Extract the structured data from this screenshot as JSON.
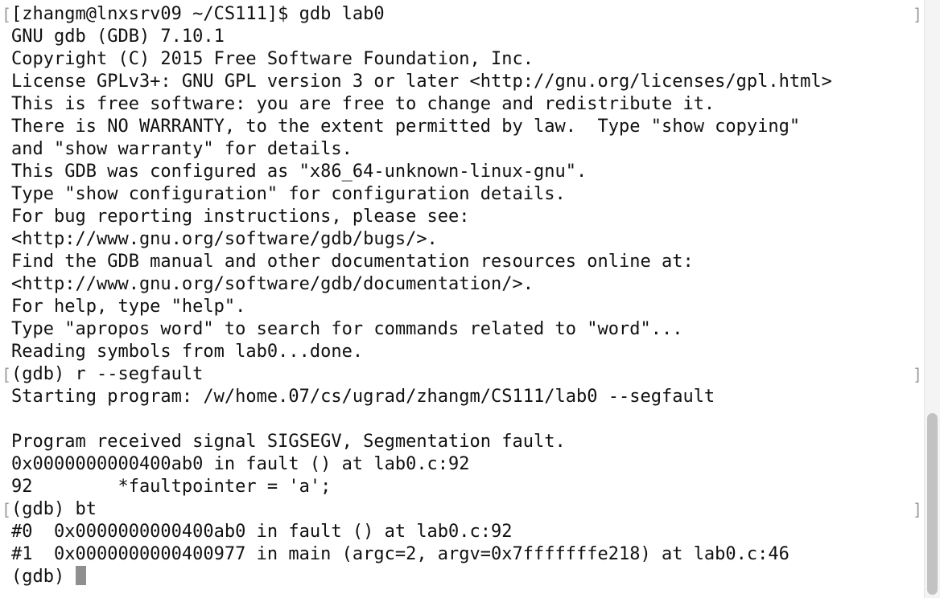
{
  "terminal": {
    "lines": [
      "[zhangm@lnxsrv09 ~/CS111]$ gdb lab0",
      "GNU gdb (GDB) 7.10.1",
      "Copyright (C) 2015 Free Software Foundation, Inc.",
      "License GPLv3+: GNU GPL version 3 or later <http://gnu.org/licenses/gpl.html>",
      "This is free software: you are free to change and redistribute it.",
      "There is NO WARRANTY, to the extent permitted by law.  Type \"show copying\"",
      "and \"show warranty\" for details.",
      "This GDB was configured as \"x86_64-unknown-linux-gnu\".",
      "Type \"show configuration\" for configuration details.",
      "For bug reporting instructions, please see:",
      "<http://www.gnu.org/software/gdb/bugs/>.",
      "Find the GDB manual and other documentation resources online at:",
      "<http://www.gnu.org/software/gdb/documentation/>.",
      "For help, type \"help\".",
      "Type \"apropos word\" to search for commands related to \"word\"...",
      "Reading symbols from lab0...done.",
      "(gdb) r --segfault",
      "Starting program: /w/home.07/cs/ugrad/zhangm/CS111/lab0 --segfault",
      "",
      "Program received signal SIGSEGV, Segmentation fault.",
      "0x0000000000400ab0 in fault () at lab0.c:92",
      "92        *faultpointer = 'a';",
      "(gdb) bt",
      "#0  0x0000000000400ab0 in fault () at lab0.c:92",
      "#1  0x0000000000400977 in main (argc=2, argv=0x7fffffffe218) at lab0.c:46"
    ],
    "prompt": "(gdb) ",
    "left_bracket": "[",
    "right_bracket": "]"
  },
  "colors": {
    "background": "#ffffff",
    "text": "#111111",
    "cursor": "#8f8f8f",
    "bracket": "#9a9a9a",
    "scrollbar_thumb": "#c2c2c2"
  }
}
